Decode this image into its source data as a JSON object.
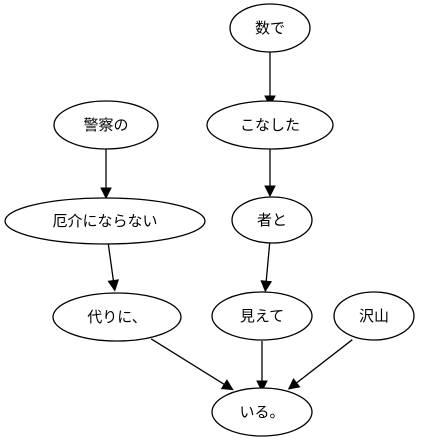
{
  "graph": {
    "nodes": [
      {
        "id": "n1",
        "label": "数で"
      },
      {
        "id": "n2",
        "label": "こなした"
      },
      {
        "id": "n3",
        "label": "者と"
      },
      {
        "id": "n4",
        "label": "見えて"
      },
      {
        "id": "n5",
        "label": "警察の"
      },
      {
        "id": "n6",
        "label": "厄介にならない"
      },
      {
        "id": "n7",
        "label": "代りに、"
      },
      {
        "id": "n8",
        "label": "沢山"
      },
      {
        "id": "n9",
        "label": "いる。"
      }
    ],
    "edges": [
      {
        "from": "n1",
        "to": "n2"
      },
      {
        "from": "n2",
        "to": "n3"
      },
      {
        "from": "n3",
        "to": "n4"
      },
      {
        "from": "n5",
        "to": "n6"
      },
      {
        "from": "n6",
        "to": "n7"
      },
      {
        "from": "n7",
        "to": "n9"
      },
      {
        "from": "n4",
        "to": "n9"
      },
      {
        "from": "n8",
        "to": "n9"
      }
    ]
  }
}
